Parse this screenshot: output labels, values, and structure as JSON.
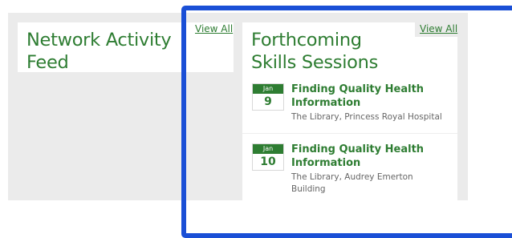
{
  "network_feed": {
    "title": "Network Activity Feed",
    "view_all_label": "View All"
  },
  "skills_sessions": {
    "title": "Forthcoming Skills Sessions",
    "view_all_label": "View All",
    "events": [
      {
        "month": "Jan",
        "day": "9",
        "title": "Finding Quality Health Information",
        "location": "The Library, Princess Royal Hospital"
      },
      {
        "month": "Jan",
        "day": "10",
        "title": "Finding Quality Health Information",
        "location": "The Library, Audrey Emerton Building"
      }
    ]
  },
  "colors": {
    "accent": "#2e7d32",
    "panel_background": "#ebebeb",
    "selection_frame": "#1a4fd6"
  }
}
